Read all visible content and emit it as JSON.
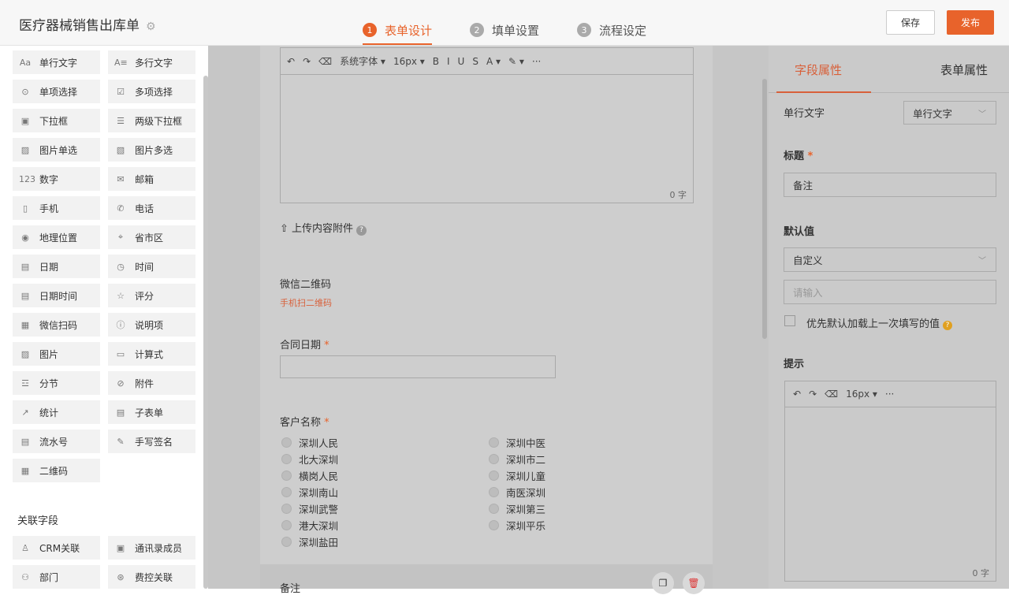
{
  "header": {
    "title": "医疗器械销售出库单",
    "steps": [
      {
        "num": "1",
        "label": "表单设计"
      },
      {
        "num": "2",
        "label": "填单设置"
      },
      {
        "num": "3",
        "label": "流程设定"
      }
    ],
    "save_label": "保存",
    "publish_label": "发布"
  },
  "sidebar": {
    "fields": [
      {
        "icon": "Aa",
        "label": "单行文字"
      },
      {
        "icon": "A≡",
        "label": "多行文字"
      },
      {
        "icon": "⊙",
        "label": "单项选择"
      },
      {
        "icon": "☑",
        "label": "多项选择"
      },
      {
        "icon": "▣",
        "label": "下拉框"
      },
      {
        "icon": "☰",
        "label": "两级下拉框"
      },
      {
        "icon": "▨",
        "label": "图片单选"
      },
      {
        "icon": "▧",
        "label": "图片多选"
      },
      {
        "icon": "123",
        "label": "数字"
      },
      {
        "icon": "✉",
        "label": "邮箱"
      },
      {
        "icon": "▯",
        "label": "手机"
      },
      {
        "icon": "✆",
        "label": "电话"
      },
      {
        "icon": "◉",
        "label": "地理位置"
      },
      {
        "icon": "⌖",
        "label": "省市区"
      },
      {
        "icon": "▤",
        "label": "日期"
      },
      {
        "icon": "◷",
        "label": "时间"
      },
      {
        "icon": "▤",
        "label": "日期时间"
      },
      {
        "icon": "☆",
        "label": "评分"
      },
      {
        "icon": "▦",
        "label": "微信扫码"
      },
      {
        "icon": "ⓘ",
        "label": "说明项"
      },
      {
        "icon": "▨",
        "label": "图片"
      },
      {
        "icon": "▭",
        "label": "计算式"
      },
      {
        "icon": "☲",
        "label": "分节"
      },
      {
        "icon": "⊘",
        "label": "附件"
      },
      {
        "icon": "↗",
        "label": "统计"
      },
      {
        "icon": "▤",
        "label": "子表单"
      },
      {
        "icon": "▤",
        "label": "流水号"
      },
      {
        "icon": "✎",
        "label": "手写签名"
      },
      {
        "icon": "▦",
        "label": "二维码"
      }
    ],
    "assoc_title": "关联字段",
    "assoc_fields": [
      {
        "icon": "♙",
        "label": "CRM关联"
      },
      {
        "icon": "▣",
        "label": "通讯录成员"
      },
      {
        "icon": "⚇",
        "label": "部门"
      },
      {
        "icon": "⊛",
        "label": "费控关联"
      }
    ]
  },
  "editor": {
    "toolbar": [
      "↶",
      "↷",
      "⌫",
      "系统字体 ▾",
      "16px ▾",
      "B",
      "I",
      "U",
      "S",
      "A ▾",
      "✎ ▾",
      "···"
    ],
    "count": "0 字"
  },
  "form": {
    "upload_label": "上传内容附件",
    "wechat_label": "微信二维码",
    "wechat_sub": "手机扫二维码",
    "contract_date_label": "合同日期",
    "customer_label": "客户名称",
    "customers_left": [
      "深圳人民",
      "北大深圳",
      "横岗人民",
      "深圳南山",
      "深圳武警",
      "港大深圳",
      "深圳盐田"
    ],
    "customers_right": [
      "深圳中医",
      "深圳市二",
      "深圳儿童",
      "南医深圳",
      "深圳第三",
      "深圳平乐"
    ],
    "remark_label": "备注",
    "required_mark": "*"
  },
  "right_panel": {
    "tab_field": "字段属性",
    "tab_form": "表单属性",
    "field_type_label": "单行文字",
    "field_type_value": "单行文字",
    "title_label": "标题",
    "title_value": "备注",
    "default_label": "默认值",
    "default_select": "自定义",
    "default_placeholder": "请输入",
    "checkbox_label": "优先默认加载上一次填写的值",
    "hint_label": "提示",
    "hint_toolbar": [
      "↶",
      "↷",
      "⌫",
      "16px ▾",
      "···"
    ],
    "hint_count": "0 字"
  },
  "colors": {
    "accent": "#e8632b",
    "overlay": "#c6c6c6"
  }
}
